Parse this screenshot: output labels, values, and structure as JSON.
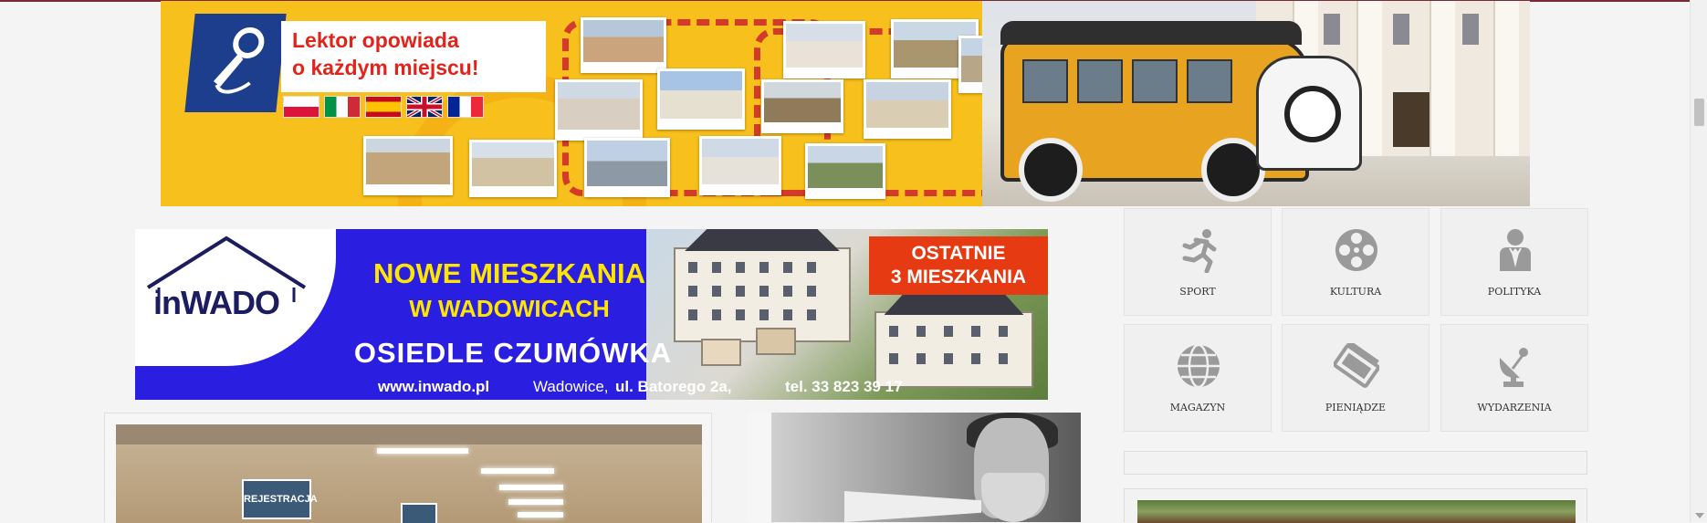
{
  "train_banner": {
    "headline_line1": "Lektor opowiada",
    "headline_line2": "o każdym miejscu!",
    "flags": [
      "Polska",
      "Italia",
      "España",
      "United Kingdom",
      "France"
    ]
  },
  "inwado_banner": {
    "logo": "inWADO",
    "headline_line1": "NOWE MIESZKANIA",
    "headline_line2": "W WADOWICACH",
    "estate": "OSIEDLE CZUMÓWKA",
    "badge_line1": "OSTATNIE",
    "badge_line2": "3 MIESZKANIA",
    "website": "www.inwado.pl",
    "city": "Wadowice,",
    "street": "ul. Batorego 2a,",
    "phone": "tel. 33 823 39 17"
  },
  "categories": [
    {
      "label": "SPORT",
      "icon": "runner-icon"
    },
    {
      "label": "KULTURA",
      "icon": "film-reel-icon"
    },
    {
      "label": "POLITYKA",
      "icon": "politician-icon"
    },
    {
      "label": "MAGAZYN",
      "icon": "globe-icon"
    },
    {
      "label": "PIENIĄDZE",
      "icon": "banknotes-icon"
    },
    {
      "label": "WYDARZENIA",
      "icon": "satellite-dish-icon"
    }
  ],
  "article_left": {
    "sign_text": "REJESTRACJA"
  },
  "colors": {
    "train_yellow": "#f8c01c",
    "inwado_blue": "#2a1fe0",
    "inwado_yellow": "#ffe600",
    "badge_red": "#e63a12",
    "icon_gray": "#9a9a9a"
  }
}
